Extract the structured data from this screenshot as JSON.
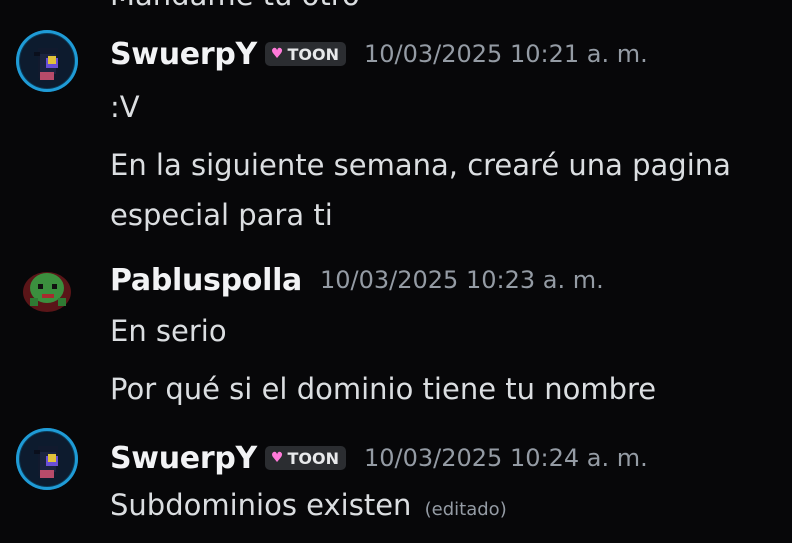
{
  "top_cut_text": "Mándame tú otro",
  "messages": [
    {
      "username": "SwuerpY",
      "tag": "TOON",
      "timestamp": "10/03/2025 10:21 a. m.",
      "lines": [
        ":V",
        "En la siguiente semana, crearé una pagina",
        "especial para ti"
      ]
    },
    {
      "username": "Pabluspolla",
      "timestamp": "10/03/2025 10:23 a. m.",
      "lines": [
        "En serio",
        "Por qué si el dominio tiene tu nombre"
      ]
    },
    {
      "username": "SwuerpY",
      "tag": "TOON",
      "timestamp": "10/03/2025 10:24 a. m.",
      "lines": [
        "Subdominios existen"
      ],
      "edited_label": "(editado)"
    }
  ],
  "colors": {
    "background": "#070709",
    "username": "#f2f3f5",
    "timestamp": "#949ba4",
    "text": "#dbdee1",
    "avatar_ring": "#1f9bd6",
    "tag_heart": "#ff7ad9"
  },
  "icons": {
    "tag_heart": "heart-icon"
  }
}
